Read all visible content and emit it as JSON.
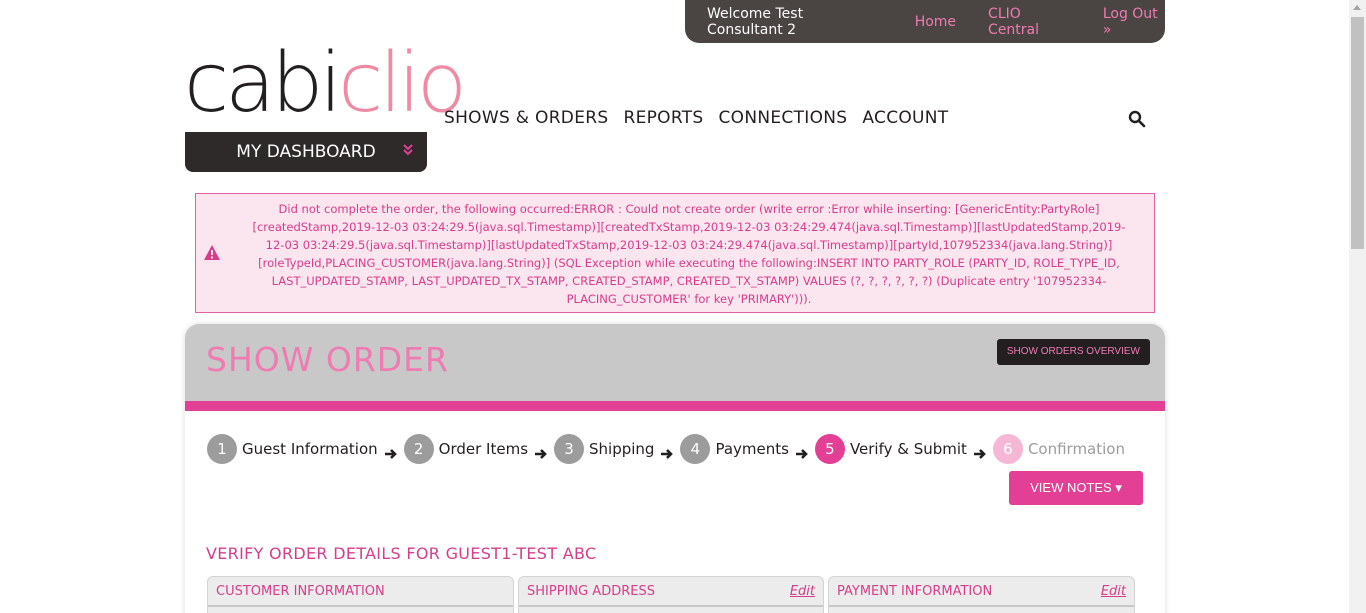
{
  "topbar": {
    "welcome": "Welcome Test Consultant 2",
    "home": "Home",
    "central": "CLIO Central",
    "logout": "Log Out »"
  },
  "logo": {
    "part1": "cabi",
    "part2": "clio"
  },
  "dashboard": {
    "label": "MY DASHBOARD",
    "caret": "»"
  },
  "nav": {
    "items": [
      "SHOWS & ORDERS",
      "REPORTS",
      "CONNECTIONS",
      "ACCOUNT"
    ]
  },
  "error": {
    "message": "Did not complete the order, the following occurred:ERROR : Could not create order (write error :Error while inserting: [GenericEntity:PartyRole][createdStamp,2019-12-03 03:24:29.5(java.sql.Timestamp)][createdTxStamp,2019-12-03 03:24:29.474(java.sql.Timestamp)][lastUpdatedStamp,2019-12-03 03:24:29.5(java.sql.Timestamp)][lastUpdatedTxStamp,2019-12-03 03:24:29.474(java.sql.Timestamp)][partyId,107952334(java.lang.String)][roleTypeId,PLACING_CUSTOMER(java.lang.String)] (SQL Exception while executing the following:INSERT INTO PARTY_ROLE (PARTY_ID, ROLE_TYPE_ID, LAST_UPDATED_STAMP, LAST_UPDATED_TX_STAMP, CREATED_STAMP, CREATED_TX_STAMP) VALUES (?, ?, ?, ?, ?, ?) (Duplicate entry '107952334-PLACING_CUSTOMER' for key 'PRIMARY'))).",
    "icon": "warning-icon"
  },
  "panel": {
    "title": "SHOW ORDER",
    "overview_button": "SHOW ORDERS OVERVIEW",
    "notes_button": "VIEW NOTES ▾",
    "verify_title": "VERIFY ORDER DETAILS FOR GUEST1-TEST ABC"
  },
  "steps": [
    {
      "num": "1",
      "label": "Guest Information",
      "state": "done"
    },
    {
      "num": "2",
      "label": "Order Items",
      "state": "done"
    },
    {
      "num": "3",
      "label": "Shipping",
      "state": "done"
    },
    {
      "num": "4",
      "label": "Payments",
      "state": "done"
    },
    {
      "num": "5",
      "label": "Verify & Submit",
      "state": "active"
    },
    {
      "num": "6",
      "label": "Confirmation",
      "state": "future"
    }
  ],
  "boxes": [
    {
      "title": "CUSTOMER INFORMATION",
      "edit": ""
    },
    {
      "title": "SHIPPING ADDRESS",
      "edit": "Edit"
    },
    {
      "title": "PAYMENT INFORMATION",
      "edit": "Edit"
    }
  ],
  "colors": {
    "accent": "#e23f95",
    "pink_light": "#ef7bb3",
    "dark": "#231f20",
    "gray_header": "#c8c8c9"
  }
}
